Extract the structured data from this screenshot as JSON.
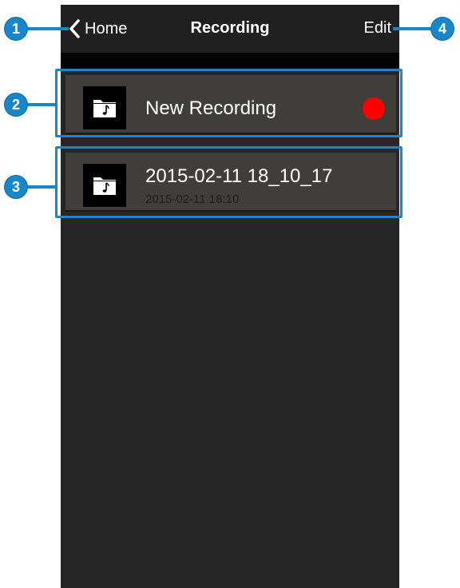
{
  "navbar": {
    "back_label": "Home",
    "title": "Recording",
    "edit_label": "Edit"
  },
  "list": {
    "items": [
      {
        "title": "New Recording",
        "subtitle": "",
        "icon": "music-folder-icon",
        "status": "recording"
      },
      {
        "title": "2015-02-11 18_10_17",
        "subtitle": "2015-02-11 18:10",
        "icon": "music-folder-icon"
      }
    ]
  },
  "callouts": [
    "1",
    "2",
    "3",
    "4"
  ],
  "colors": {
    "callout": "#1887c9",
    "record_dot": "#ff0000",
    "row_background": "#403d3b",
    "screen_background": "#252525"
  }
}
